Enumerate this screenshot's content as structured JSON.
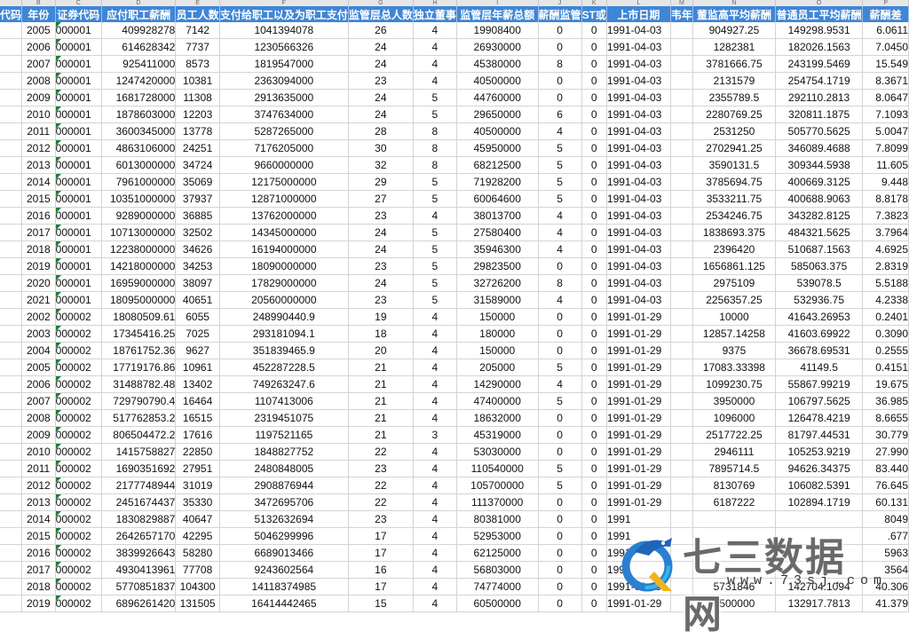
{
  "column_letters": [
    "",
    "B",
    "C",
    "D",
    "E",
    "F",
    "G",
    "H",
    "I",
    "J",
    "K",
    "L",
    "M",
    "N",
    "O",
    "P"
  ],
  "headers": [
    "代码",
    "年份",
    "证券代码",
    "应付职工薪酬",
    "员工人数",
    "支付给职工以及为职工支付",
    "监管层总人数",
    "独立董事",
    "监管层年薪总额",
    "薪酬监管",
    "ST或",
    "上市日期",
    "韦年",
    "董监高平均薪酬",
    "普通员工平均薪酬",
    "薪酬差"
  ],
  "rows": [
    [
      "",
      "2005",
      "000001",
      "409928278",
      "7142",
      "1041394078",
      "26",
      "4",
      "19908400",
      "0",
      "0",
      "1991-04-03",
      "",
      "904927.25",
      "149298.9531",
      "6.0611"
    ],
    [
      "",
      "2006",
      "000001",
      "614628342",
      "7737",
      "1230566326",
      "24",
      "4",
      "26930000",
      "0",
      "0",
      "1991-04-03",
      "",
      "1282381",
      "182026.1563",
      "7.0450"
    ],
    [
      "",
      "2007",
      "000001",
      "925411000",
      "8573",
      "1819547000",
      "24",
      "4",
      "45380000",
      "8",
      "0",
      "1991-04-03",
      "",
      "3781666.75",
      "243199.5469",
      "15.549"
    ],
    [
      "",
      "2008",
      "000001",
      "1247420000",
      "10381",
      "2363094000",
      "23",
      "4",
      "40500000",
      "0",
      "0",
      "1991-04-03",
      "",
      "2131579",
      "254754.1719",
      "8.3671"
    ],
    [
      "",
      "2009",
      "000001",
      "1681728000",
      "11308",
      "2913635000",
      "24",
      "5",
      "44760000",
      "0",
      "0",
      "1991-04-03",
      "",
      "2355789.5",
      "292110.2813",
      "8.0647"
    ],
    [
      "",
      "2010",
      "000001",
      "1878603000",
      "12203",
      "3747634000",
      "24",
      "5",
      "29650000",
      "6",
      "0",
      "1991-04-03",
      "",
      "2280769.25",
      "320811.1875",
      "7.1093"
    ],
    [
      "",
      "2011",
      "000001",
      "3600345000",
      "13778",
      "5287265000",
      "28",
      "8",
      "40500000",
      "4",
      "0",
      "1991-04-03",
      "",
      "2531250",
      "505770.5625",
      "5.0047"
    ],
    [
      "",
      "2012",
      "000001",
      "4863106000",
      "24251",
      "7176205000",
      "30",
      "8",
      "45950000",
      "5",
      "0",
      "1991-04-03",
      "",
      "2702941.25",
      "346089.4688",
      "7.8099"
    ],
    [
      "",
      "2013",
      "000001",
      "6013000000",
      "34724",
      "9660000000",
      "32",
      "8",
      "68212500",
      "5",
      "0",
      "1991-04-03",
      "",
      "3590131.5",
      "309344.5938",
      "11.605"
    ],
    [
      "",
      "2014",
      "000001",
      "7961000000",
      "35069",
      "12175000000",
      "29",
      "5",
      "71928200",
      "5",
      "0",
      "1991-04-03",
      "",
      "3785694.75",
      "400669.3125",
      "9.448"
    ],
    [
      "",
      "2015",
      "000001",
      "10351000000",
      "37937",
      "12871000000",
      "27",
      "5",
      "60064600",
      "5",
      "0",
      "1991-04-03",
      "",
      "3533211.75",
      "400688.9063",
      "8.8178"
    ],
    [
      "",
      "2016",
      "000001",
      "9289000000",
      "36885",
      "13762000000",
      "23",
      "4",
      "38013700",
      "4",
      "0",
      "1991-04-03",
      "",
      "2534246.75",
      "343282.8125",
      "7.3823"
    ],
    [
      "",
      "2017",
      "000001",
      "10713000000",
      "32502",
      "14345000000",
      "24",
      "5",
      "27580400",
      "4",
      "0",
      "1991-04-03",
      "",
      "1838693.375",
      "484321.5625",
      "3.7964"
    ],
    [
      "",
      "2018",
      "000001",
      "12238000000",
      "34626",
      "16194000000",
      "24",
      "5",
      "35946300",
      "4",
      "0",
      "1991-04-03",
      "",
      "2396420",
      "510687.1563",
      "4.6925"
    ],
    [
      "",
      "2019",
      "000001",
      "14218000000",
      "34253",
      "18090000000",
      "23",
      "5",
      "29823500",
      "0",
      "0",
      "1991-04-03",
      "",
      "1656861.125",
      "585063.375",
      "2.8319"
    ],
    [
      "",
      "2020",
      "000001",
      "16959000000",
      "38097",
      "17829000000",
      "24",
      "5",
      "32726200",
      "8",
      "0",
      "1991-04-03",
      "",
      "2975109",
      "539078.5",
      "5.5188"
    ],
    [
      "",
      "2021",
      "000001",
      "18095000000",
      "40651",
      "20560000000",
      "23",
      "5",
      "31589000",
      "4",
      "0",
      "1991-04-03",
      "",
      "2256357.25",
      "532936.75",
      "4.2338"
    ],
    [
      "",
      "2002",
      "000002",
      "18080509.61",
      "6055",
      "248990440.9",
      "19",
      "4",
      "150000",
      "0",
      "0",
      "1991-01-29",
      "",
      "10000",
      "41643.26953",
      "0.2401"
    ],
    [
      "",
      "2003",
      "000002",
      "17345416.25",
      "7025",
      "293181094.1",
      "18",
      "4",
      "180000",
      "0",
      "0",
      "1991-01-29",
      "",
      "12857.14258",
      "41603.69922",
      "0.3090"
    ],
    [
      "",
      "2004",
      "000002",
      "18761752.36",
      "9627",
      "351839465.9",
      "20",
      "4",
      "150000",
      "0",
      "0",
      "1991-01-29",
      "",
      "9375",
      "36678.69531",
      "0.2555"
    ],
    [
      "",
      "2005",
      "000002",
      "17719176.86",
      "10961",
      "452287228.5",
      "21",
      "4",
      "205000",
      "5",
      "0",
      "1991-01-29",
      "",
      "17083.33398",
      "41149.5",
      "0.4151"
    ],
    [
      "",
      "2006",
      "000002",
      "31488782.48",
      "13402",
      "749263247.6",
      "21",
      "4",
      "14290000",
      "4",
      "0",
      "1991-01-29",
      "",
      "1099230.75",
      "55867.99219",
      "19.675"
    ],
    [
      "",
      "2007",
      "000002",
      "729790790.4",
      "16464",
      "1107413006",
      "21",
      "4",
      "47400000",
      "5",
      "0",
      "1991-01-29",
      "",
      "3950000",
      "106797.5625",
      "36.985"
    ],
    [
      "",
      "2008",
      "000002",
      "517762853.2",
      "16515",
      "2319451075",
      "21",
      "4",
      "18632000",
      "0",
      "0",
      "1991-01-29",
      "",
      "1096000",
      "126478.4219",
      "8.6655"
    ],
    [
      "",
      "2009",
      "000002",
      "806504472.2",
      "17616",
      "1197521165",
      "21",
      "3",
      "45319000",
      "0",
      "0",
      "1991-01-29",
      "",
      "2517722.25",
      "81797.44531",
      "30.779"
    ],
    [
      "",
      "2010",
      "000002",
      "1415758827",
      "22850",
      "1848827752",
      "22",
      "4",
      "53030000",
      "0",
      "0",
      "1991-01-29",
      "",
      "2946111",
      "105253.9219",
      "27.990"
    ],
    [
      "",
      "2011",
      "000002",
      "1690351692",
      "27951",
      "2480848005",
      "23",
      "4",
      "110540000",
      "5",
      "0",
      "1991-01-29",
      "",
      "7895714.5",
      "94626.34375",
      "83.440"
    ],
    [
      "",
      "2012",
      "000002",
      "2177748944",
      "31019",
      "2908876944",
      "22",
      "4",
      "105700000",
      "5",
      "0",
      "1991-01-29",
      "",
      "8130769",
      "106082.5391",
      "76.645"
    ],
    [
      "",
      "2013",
      "000002",
      "2451674437",
      "35330",
      "3472695706",
      "22",
      "4",
      "111370000",
      "0",
      "0",
      "1991-01-29",
      "",
      "6187222",
      "102894.1719",
      "60.131"
    ],
    [
      "",
      "2014",
      "000002",
      "1830829887",
      "40647",
      "5132632694",
      "23",
      "4",
      "80381000",
      "0",
      "0",
      "1991",
      "",
      "",
      "",
      "8049"
    ],
    [
      "",
      "2015",
      "000002",
      "2642657170",
      "42295",
      "5046299996",
      "17",
      "4",
      "52953000",
      "0",
      "0",
      "1991",
      "",
      "",
      "",
      ".677"
    ],
    [
      "",
      "2016",
      "000002",
      "3839926643",
      "58280",
      "6689013466",
      "17",
      "4",
      "62125000",
      "0",
      "0",
      "1991",
      "",
      "",
      "",
      "5963"
    ],
    [
      "",
      "2017",
      "000002",
      "4930413961",
      "77708",
      "9243602564",
      "16",
      "4",
      "56803000",
      "0",
      "0",
      "1991",
      "",
      "",
      "",
      "3564"
    ],
    [
      "",
      "2018",
      "000002",
      "5770851837",
      "104300",
      "14118374985",
      "17",
      "4",
      "74774000",
      "0",
      "0",
      "1991-01-29",
      "",
      "5731846",
      "142704.1094",
      "40.306"
    ],
    [
      "",
      "2019",
      "000002",
      "6896261420",
      "131505",
      "16414442465",
      "15",
      "4",
      "60500000",
      "0",
      "0",
      "1991-01-29",
      "",
      "5500000",
      "132917.7813",
      "41.379"
    ]
  ],
  "watermark": {
    "title": "七三数据网",
    "url": "www.73sj.com"
  },
  "colors": {
    "header_bg": "#3f86d6",
    "header_text": "#ffffff",
    "grid": "#d4d4d4",
    "marker": "#1e7e34"
  }
}
